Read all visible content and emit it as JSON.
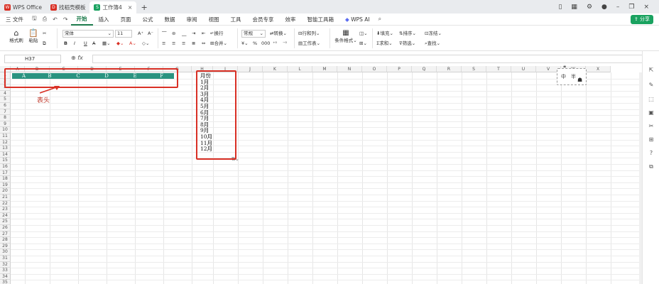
{
  "tabs": [
    {
      "label": "WPS Office",
      "icon": "wps-logo-icon",
      "color": "#d93025"
    },
    {
      "label": "找稻壳模板",
      "icon": "docer-icon",
      "color": "#d93025"
    },
    {
      "label": "工作簿4",
      "icon": "spreadsheet-icon",
      "color": "#1aa260"
    }
  ],
  "menu": {
    "file": "三 文件",
    "items": [
      "开始",
      "插入",
      "页面",
      "公式",
      "数据",
      "审阅",
      "视图",
      "工具",
      "会员专享",
      "效率",
      "智能工具箱"
    ],
    "active": "开始",
    "ai": "WPS AI",
    "share": "分享"
  },
  "ribbon": {
    "format_painter": "格式刷",
    "paste": "粘贴",
    "font": "宋体",
    "size": "11",
    "bold": "B",
    "italic": "I",
    "underline": "U",
    "wrap": "换行",
    "merge": "合并",
    "number_format": "常规",
    "convert": "转换",
    "rowcol": "行和列",
    "worksheet": "工作表",
    "cond_format": "条件格式",
    "fill": "填充",
    "sort": "排序",
    "freeze": "冻结",
    "sum": "求和",
    "filter": "筛选",
    "find": "查找"
  },
  "formula": {
    "namebox": "H37",
    "fx": "fx"
  },
  "columns": [
    "A",
    "B",
    "C",
    "D",
    "E",
    "F",
    "G",
    "H",
    "I",
    "J",
    "K",
    "L",
    "M",
    "N",
    "O",
    "P",
    "Q",
    "R",
    "S",
    "T",
    "U",
    "V",
    "W",
    "X"
  ],
  "header_cells": [
    "A",
    "B",
    "C",
    "D",
    "E",
    "F"
  ],
  "months": [
    "月份",
    "1月",
    "2月",
    "3月",
    "4月",
    "5月",
    "6月",
    "7月",
    "8月",
    "9月",
    "10月",
    "11月",
    "12月"
  ],
  "annotation": "表头",
  "ime": {
    "c1": "中",
    "c2": "半"
  },
  "colors": {
    "accent": "#1b7a4b",
    "header_fill": "#2a9380",
    "annotation": "#d93025"
  }
}
